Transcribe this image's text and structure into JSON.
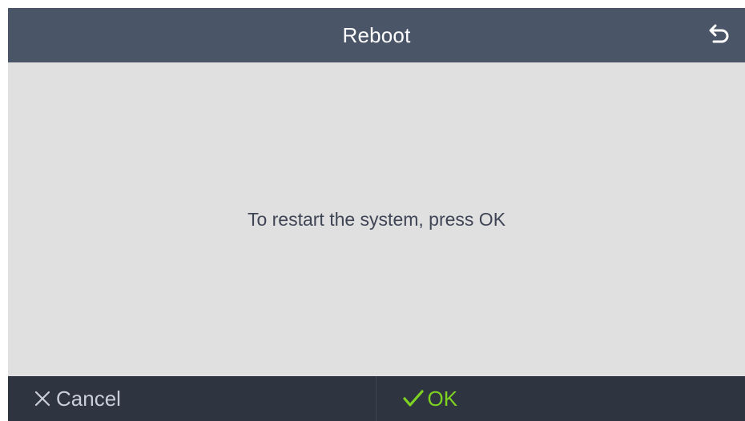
{
  "header": {
    "title": "Reboot",
    "back_icon": "back-arrow-icon"
  },
  "main": {
    "message": "To restart the system, press OK"
  },
  "footer": {
    "cancel_label": "Cancel",
    "cancel_icon": "close-icon",
    "ok_label": "OK",
    "ok_icon": "checkmark-icon"
  },
  "colors": {
    "header_bg": "#4b5568",
    "body_bg": "#e0e0e0",
    "footer_bg": "#2f3441",
    "ok_accent": "#7ed321",
    "cancel_text": "#c9ced8"
  }
}
